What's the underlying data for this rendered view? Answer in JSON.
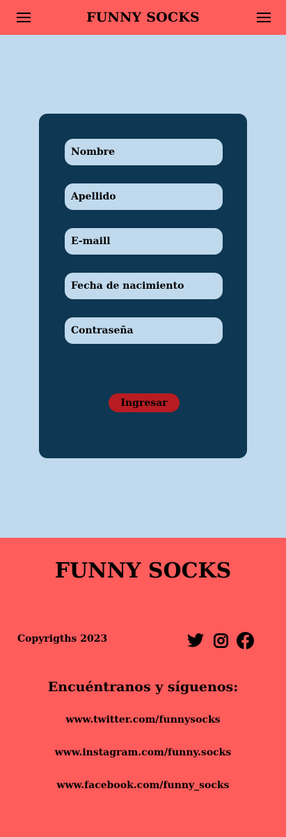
{
  "header": {
    "brand": "FUNNY SOCKS",
    "left_icon": "hamburger-menu-icon",
    "right_icon": "hamburger-menu-icon"
  },
  "form": {
    "fields": [
      {
        "placeholder": "Nombre"
      },
      {
        "placeholder": "Apellido"
      },
      {
        "placeholder": "E-maill"
      },
      {
        "placeholder": "Fecha de nacimiento"
      },
      {
        "placeholder": "Contraseña"
      }
    ],
    "submit_label": "Ingresar"
  },
  "footer": {
    "brand": "FUNNY SOCKS",
    "copyright": "Copyrigths 2023",
    "social_icons": [
      "twitter-icon",
      "instagram-icon",
      "facebook-icon"
    ],
    "find_us": "Encuéntranos y síguenos:",
    "links": [
      "www.twitter.com/funnysocks",
      "www.instagram.com/funny.socks",
      "www.facebook.com/funny_socks"
    ]
  },
  "colors": {
    "header_footer_bg": "#ff5c5c",
    "page_bg": "#c0d9ec",
    "card_bg": "#0d3752",
    "field_bg": "#c0d9ec",
    "button_bg": "#b81c22"
  }
}
